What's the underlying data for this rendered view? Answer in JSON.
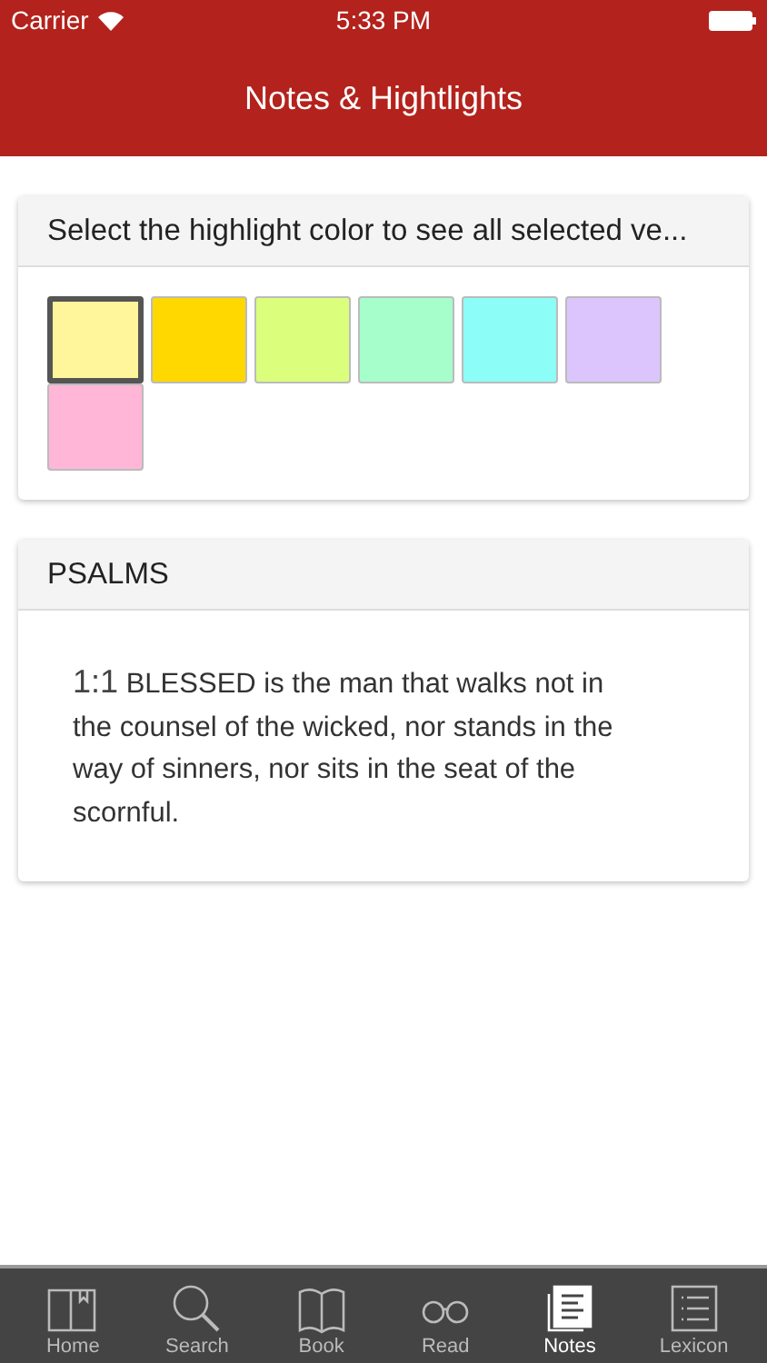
{
  "status_bar": {
    "carrier": "Carrier",
    "time": "5:33 PM"
  },
  "nav": {
    "title": "Notes & Hightlights"
  },
  "color_card": {
    "title": "Select the highlight color to see all selected ve...",
    "colors": [
      {
        "color": "#fff59a",
        "selected": true
      },
      {
        "color": "#ffd800",
        "selected": false
      },
      {
        "color": "#dbff7c",
        "selected": false
      },
      {
        "color": "#a6ffcb",
        "selected": false
      },
      {
        "color": "#8cfdf7",
        "selected": false
      },
      {
        "color": "#dcc5fc",
        "selected": false
      },
      {
        "color": "#ffb6d7",
        "selected": false
      }
    ]
  },
  "notes": [
    {
      "book": "PSALMS",
      "verses": [
        {
          "ref": "1:1",
          "text": "BLESSED is the man that walks not in the counsel of the wicked, nor stands in the way of sinners, nor sits in the seat of the scornful."
        }
      ]
    }
  ],
  "tab_bar": [
    {
      "kind": "home",
      "label": "Home",
      "selected": false
    },
    {
      "kind": "search",
      "label": "Search",
      "selected": false
    },
    {
      "kind": "book",
      "label": "Book",
      "selected": false
    },
    {
      "kind": "read",
      "label": "Read",
      "selected": false
    },
    {
      "kind": "notes",
      "label": "Notes",
      "selected": true
    },
    {
      "kind": "lexicon",
      "label": "Lexicon",
      "selected": false
    }
  ]
}
